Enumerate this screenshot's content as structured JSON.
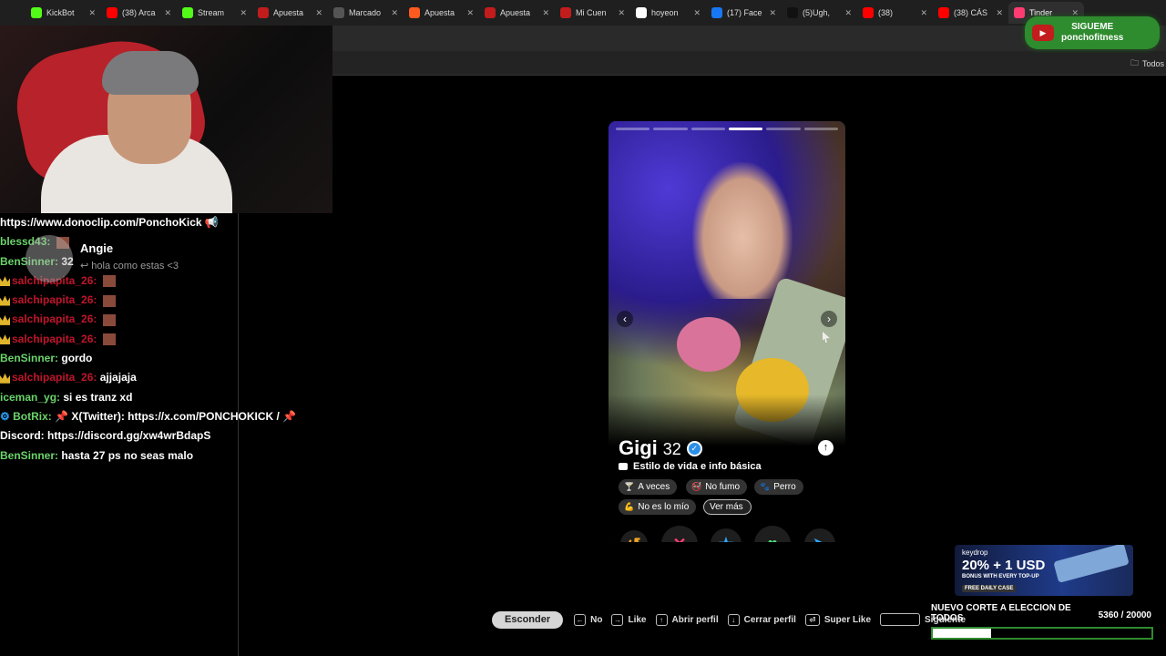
{
  "browser": {
    "tabs": [
      {
        "label": "KickBot",
        "icon": "kick-icon",
        "color": "#53fc18"
      },
      {
        "label": "(38) Arca",
        "icon": "youtube-icon",
        "color": "#ff0000"
      },
      {
        "label": "Stream",
        "icon": "kick-icon",
        "color": "#53fc18"
      },
      {
        "label": "Apuesta",
        "icon": "app-icon",
        "color": "#c21c1c"
      },
      {
        "label": "Marcado",
        "icon": "app-icon",
        "color": "#555555"
      },
      {
        "label": "Apuesta",
        "icon": "app-icon",
        "color": "#ff5a1f"
      },
      {
        "label": "Apuesta",
        "icon": "app-icon",
        "color": "#c21c1c"
      },
      {
        "label": "Mi Cuen",
        "icon": "app-icon",
        "color": "#c21c1c"
      },
      {
        "label": "hoyeon",
        "icon": "google-icon",
        "color": "#ffffff"
      },
      {
        "label": "(17) Face",
        "icon": "facebook-icon",
        "color": "#1877f2"
      },
      {
        "label": "(5)Ugh,",
        "icon": "tiktok-icon",
        "color": "#111111"
      },
      {
        "label": "(38)",
        "icon": "youtube-icon",
        "color": "#ff0000"
      },
      {
        "label": "(38) CÁS",
        "icon": "youtube-icon",
        "color": "#ff0000"
      },
      {
        "label": "Tinder",
        "icon": "tinder-icon",
        "color": "#fe3c72",
        "active": true
      }
    ],
    "bookmarks_all": "Todos"
  },
  "overlay_follow": {
    "line1": "SIGUEME",
    "line2": "ponchofitness"
  },
  "chat": {
    "messages": [
      {
        "user": "",
        "text": "https://www.donoclip.com/PonchoKick 📢",
        "style": "plain"
      },
      {
        "user": "blessd43:",
        "text": "",
        "style": "green",
        "emote": true
      },
      {
        "user": "BenSinner:",
        "text": "32",
        "style": "green"
      },
      {
        "user": "salchipapita_26:",
        "text": "",
        "style": "red",
        "crown": true,
        "emote": true
      },
      {
        "user": "salchipapita_26:",
        "text": "",
        "style": "red",
        "crown": true,
        "emote": true
      },
      {
        "user": "salchipapita_26:",
        "text": "",
        "style": "red",
        "crown": true,
        "emote": true
      },
      {
        "user": "salchipapita_26:",
        "text": "",
        "style": "red",
        "crown": true,
        "emote": true
      },
      {
        "user": "BenSinner:",
        "text": "gordo",
        "style": "green"
      },
      {
        "user": "salchipapita_26:",
        "text": "ajjajaja",
        "style": "red",
        "crown": true
      },
      {
        "user": "iceman_yg:",
        "text": "si es tranz xd",
        "style": "green"
      },
      {
        "user": "BotRix:",
        "text": "📌 X(Twitter): https://x.com/PONCHOKICK / 📌",
        "style": "green",
        "bot": true
      },
      {
        "user": "",
        "text": "Discord: https://discord.gg/xw4wrBdapS",
        "style": "plain"
      },
      {
        "user": "BenSinner:",
        "text": "hasta 27 ps no seas malo",
        "style": "green"
      }
    ],
    "popup": {
      "name": "Angie",
      "reply": "↩ hola como estas <3"
    }
  },
  "profile": {
    "name": "Gigi",
    "age": "32",
    "section_title": "Estilo de vida e info básica",
    "chips": [
      "A veces",
      "No fumo",
      "Perro",
      "No es lo mío",
      "Ver más"
    ],
    "photo_count": 6,
    "current_photo": 4
  },
  "actions": [
    {
      "name": "rewind-button",
      "glyph": "↺",
      "color": "#f5a623"
    },
    {
      "name": "nope-button",
      "glyph": "✕",
      "color": "#fe3c72"
    },
    {
      "name": "super-like-button",
      "glyph": "★",
      "color": "#2ba7ff"
    },
    {
      "name": "like-button",
      "glyph": "♥",
      "color": "#4ce27b"
    },
    {
      "name": "boost-button",
      "glyph": "➤",
      "color": "#2ba7ff"
    }
  ],
  "shortcuts": {
    "hide": "Esconder",
    "items": [
      "No",
      "Like",
      "Abrir perfil",
      "Cerrar perfil",
      "Super Like",
      "Siguiente"
    ]
  },
  "keydrop": {
    "brand": "keydrop",
    "headline": "20% + 1 USD",
    "sub": "BONUS WITH EVERY TOP-UP",
    "free": "FREE DAILY CASE"
  },
  "goal": {
    "title": "NUEVO CORTE A ELECCION DE TODOS",
    "current": 5360,
    "target": 20000,
    "count_text": "5360 / 20000"
  }
}
